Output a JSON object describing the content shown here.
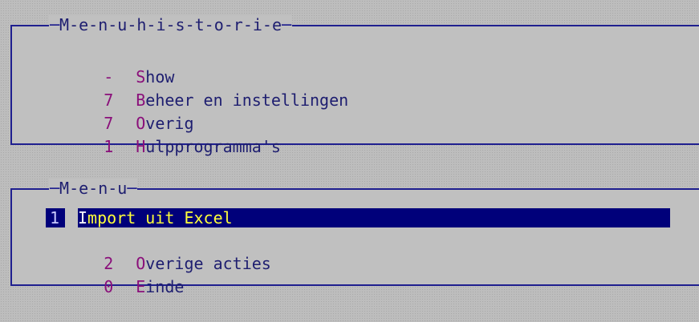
{
  "history": {
    "title": "M-e-n-u-h-i-s-t-o-r-i-e",
    "items": [
      {
        "key": "-",
        "hot": "S",
        "rest": "how"
      },
      {
        "key": "7",
        "hot": "B",
        "rest": "eheer en instellingen"
      },
      {
        "key": "7",
        "hot": "O",
        "rest": "verig"
      },
      {
        "key": "1",
        "hot": "H",
        "rest": "ulpprogramma's"
      }
    ]
  },
  "menu": {
    "title": "M-e-n-u",
    "items": [
      {
        "key": "1",
        "hot": "I",
        "rest": "mport uit Excel",
        "selected": true
      },
      {
        "key": "2",
        "hot": "O",
        "rest": "verige acties"
      },
      {
        "key": "0",
        "hot": "E",
        "rest": "inde"
      }
    ]
  },
  "colors": {
    "frame": "#1f1f8f",
    "text": "#1e1e70",
    "hotkey": "#8a0f7a",
    "selection_bg": "#00007a",
    "selection_text": "#ffff3a"
  }
}
